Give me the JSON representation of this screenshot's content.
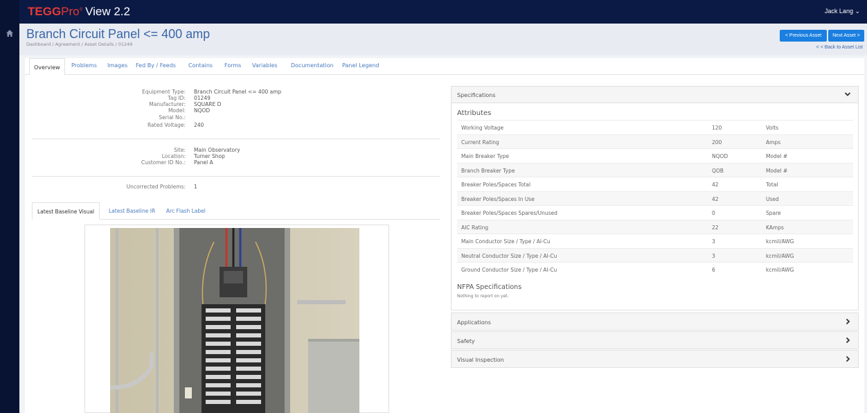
{
  "app": {
    "brand_a": "TEGG",
    "brand_b": "Pro",
    "brand_tm": "®",
    "brand_version": "View 2.2",
    "user_menu": "Jack Lang ⌄"
  },
  "header": {
    "title": "Branch Circuit Panel <= 400 amp",
    "breadcrumb": "Dashboard /  Agreement /  Asset Details /  01249",
    "prev_label": "< Previous Asset",
    "next_label": "Next Asset >",
    "back_label": "< < Back to Asset List"
  },
  "tabs": [
    "Overview",
    "Problems",
    "Images",
    "Fed By / Feeds",
    "Contains",
    "Forms",
    "Variables",
    "Documentation",
    "Panel Legend"
  ],
  "details": {
    "group1": [
      {
        "k": "Equipment Type:",
        "v": "Branch Circuit Panel <= 400 amp"
      },
      {
        "k": "Tag ID:",
        "v": "01249"
      },
      {
        "k": "Manufacturer:",
        "v": "SQUARE D"
      },
      {
        "k": "Model:",
        "v": "NQOD"
      },
      {
        "k": "Serial No.:",
        "v": ""
      },
      {
        "k": "Rated Voltage:",
        "v": "240"
      }
    ],
    "group2": [
      {
        "k": "Site:",
        "v": "Main Observatory"
      },
      {
        "k": "Location:",
        "v": "Turner Shop"
      },
      {
        "k": "Customer ID No.:",
        "v": "Panel A"
      }
    ],
    "group3": [
      {
        "k": "Uncorrected Problems:",
        "v": "1"
      }
    ]
  },
  "subtabs": [
    "Latest Baseline Visual",
    "Latest Baseline IR",
    "Arc Flash Label"
  ],
  "specifications": {
    "title": "Specifications",
    "attributes_title": "Attributes",
    "rows": [
      {
        "name": "Working Voltage",
        "value": "120",
        "unit": "Volts"
      },
      {
        "name": "Current Rating",
        "value": "200",
        "unit": "Amps"
      },
      {
        "name": "Main Breaker Type",
        "value": "NQOD",
        "unit": "Model #"
      },
      {
        "name": "Branch Breaker Type",
        "value": "QOB",
        "unit": "Model #"
      },
      {
        "name": "Breaker Poles/Spaces Total",
        "value": "42",
        "unit": "Total"
      },
      {
        "name": "Breaker Poles/Spaces In Use",
        "value": "42",
        "unit": "Used"
      },
      {
        "name": "Breaker Poles/Spaces Spares/Unused",
        "value": "0",
        "unit": "Spare"
      },
      {
        "name": "AIC Rating",
        "value": "22",
        "unit": "KAmps"
      },
      {
        "name": "Main Conductor Size / Type / Al-Cu",
        "value": "3",
        "unit": "kcmil/AWG"
      },
      {
        "name": "Neutral Conductor Size / Type / Al-Cu",
        "value": "3",
        "unit": "kcmil/AWG"
      },
      {
        "name": "Ground Conductor Size / Type / Al-Cu",
        "value": "6",
        "unit": "kcmil/AWG"
      }
    ],
    "nfpa_title": "NFPA Specifications",
    "nfpa_note": "Nothing to report on yet."
  },
  "panels": [
    "Applications",
    "Safety",
    "Visual Inspection"
  ],
  "colors": {
    "navy": "#0b1a45",
    "accent": "#1a7fe0",
    "link": "#4a7bbf",
    "brand_red": "#e53935"
  }
}
